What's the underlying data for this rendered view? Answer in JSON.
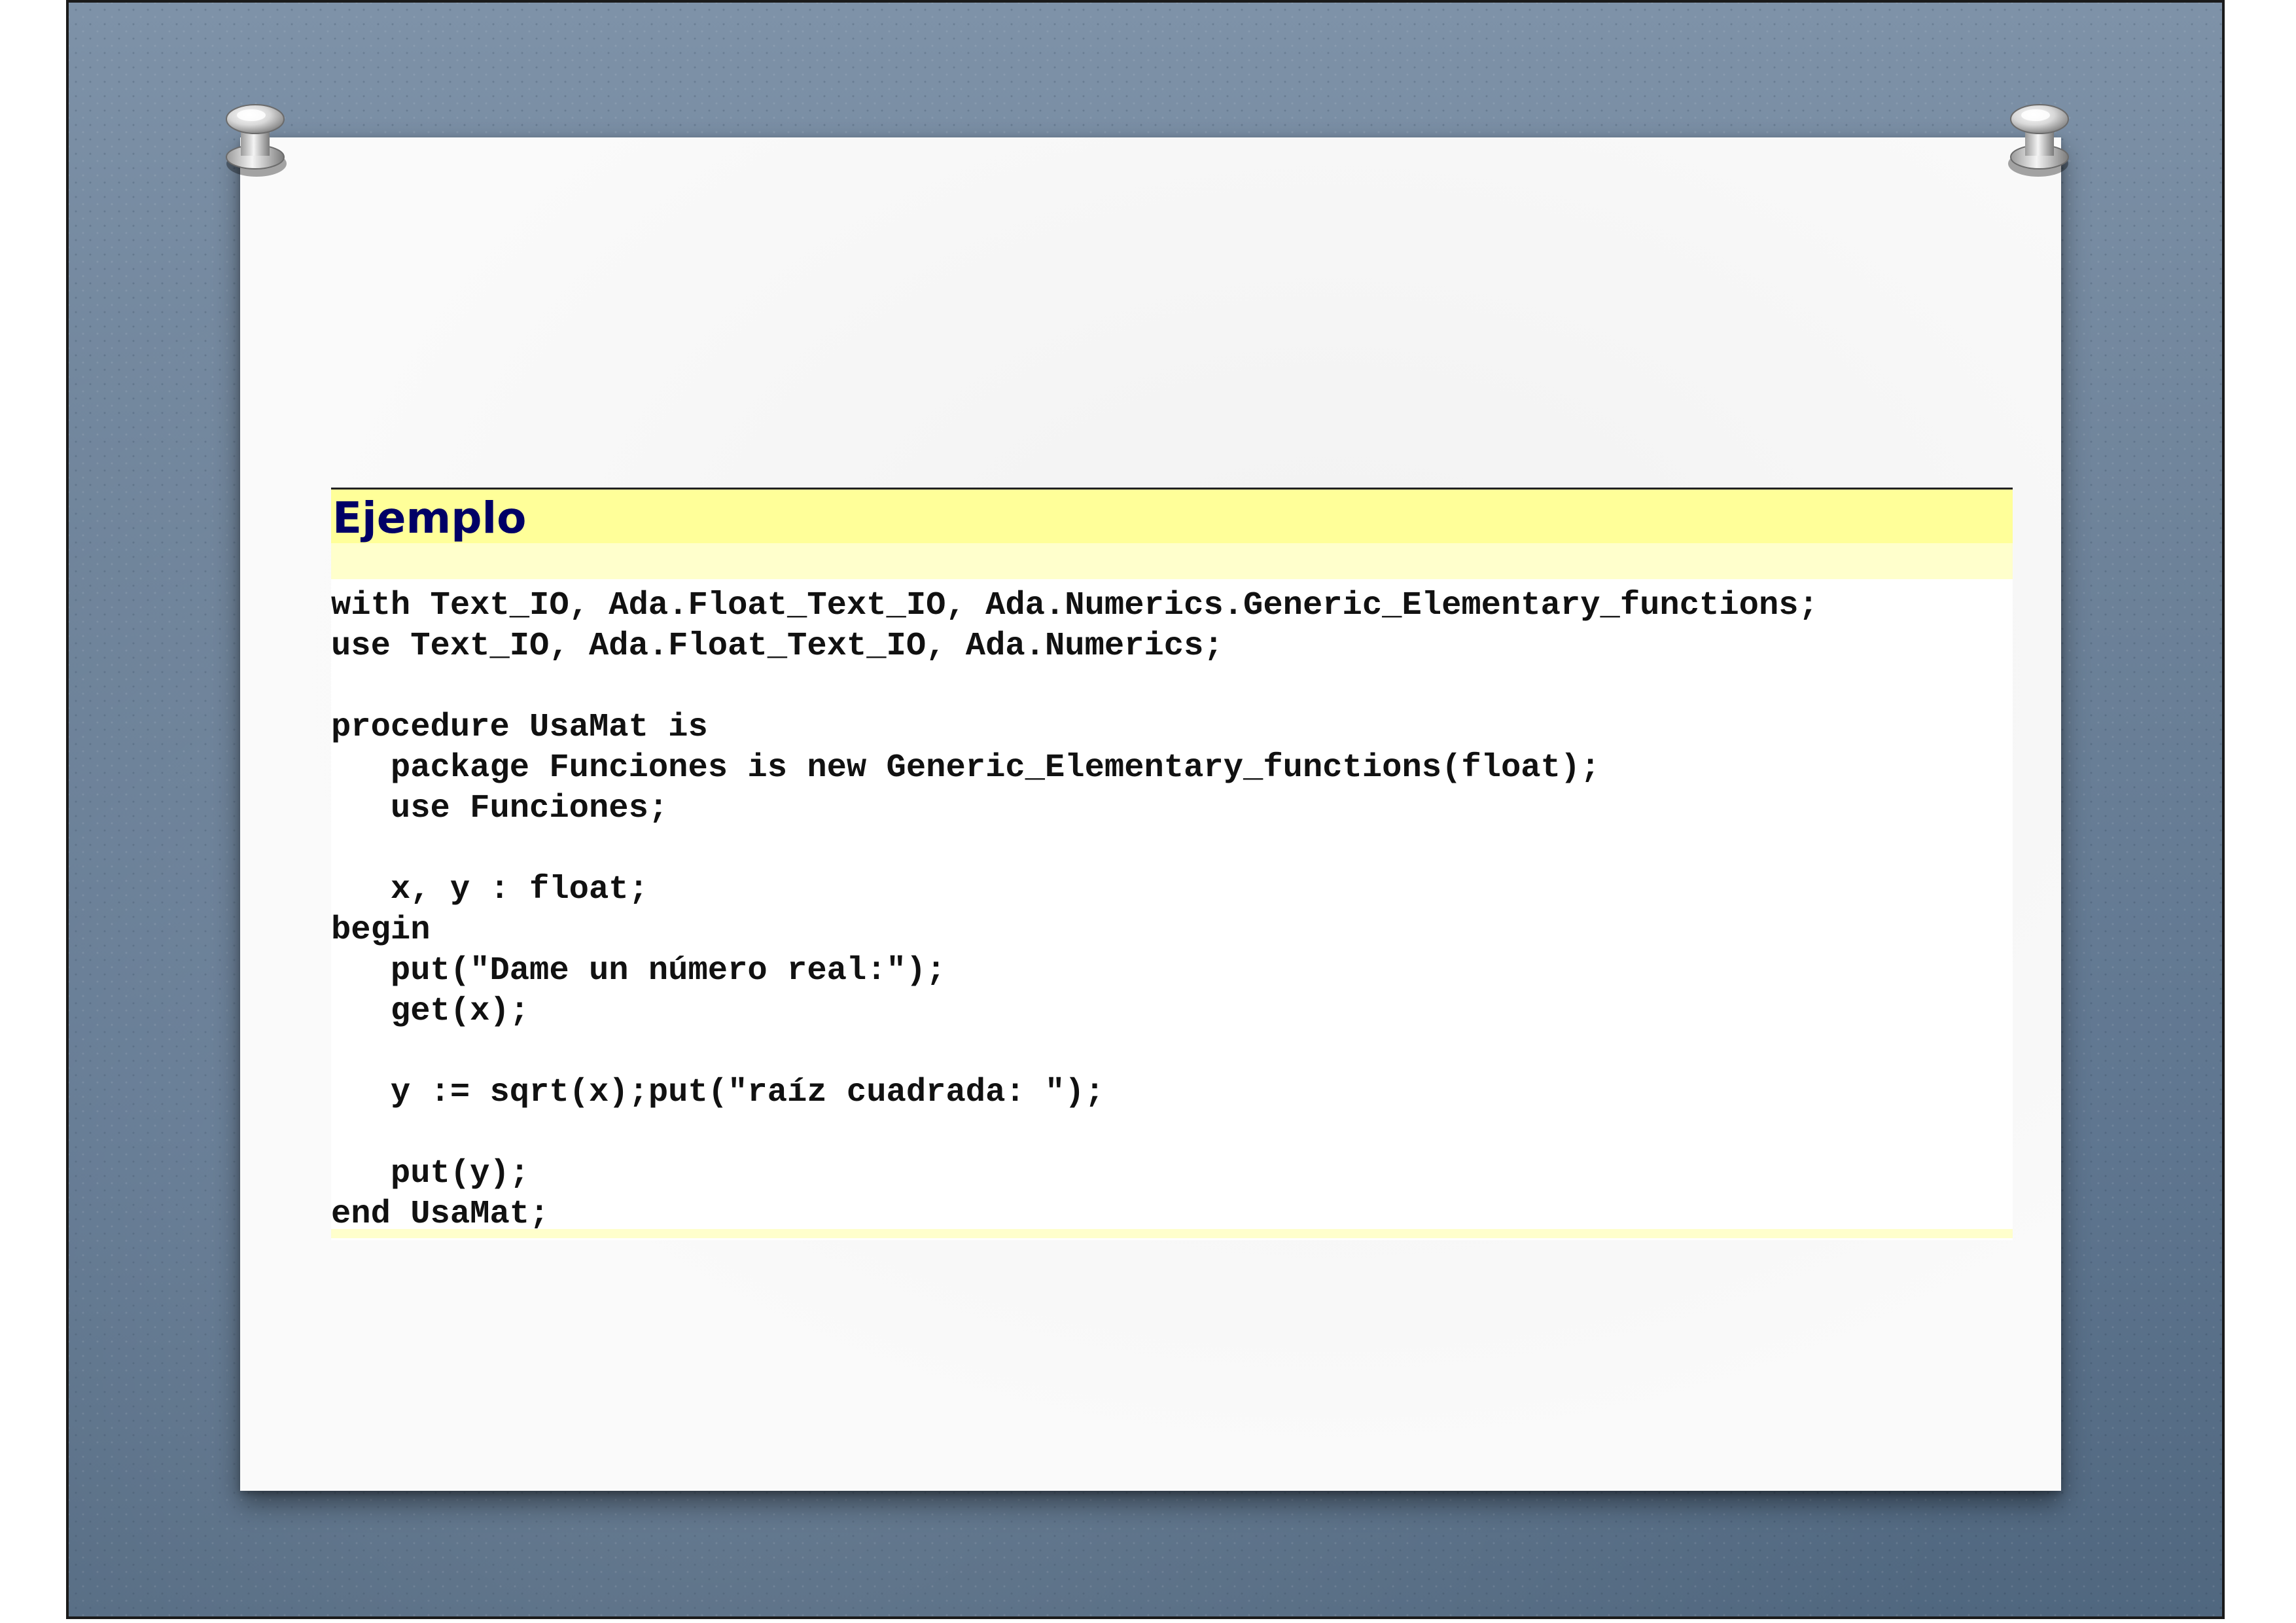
{
  "slide": {
    "heading": "Ejemplo",
    "code_lines": [
      "with Text_IO, Ada.Float_Text_IO, Ada.Numerics.Generic_Elementary_functions;",
      "use Text_IO, Ada.Float_Text_IO, Ada.Numerics;",
      "",
      "procedure UsaMat is",
      "   package Funciones is new Generic_Elementary_functions(float);",
      "   use Funciones;",
      "",
      "   x, y : float;",
      "begin",
      "   put(\"Dame un número real:\");",
      "   get(x);",
      "",
      "   y := sqrt(x);put(\"raíz cuadrada: \");",
      "",
      "   put(y);",
      "end UsaMat;"
    ]
  },
  "colors": {
    "heading_text": "#000066",
    "heading_bar": "#ffff99",
    "heading_sub_bar": "#ffffcc",
    "slide_background": "#6d8299",
    "paper": "#fafafa"
  },
  "icons": [
    "push-pin-icon",
    "push-pin-icon"
  ]
}
